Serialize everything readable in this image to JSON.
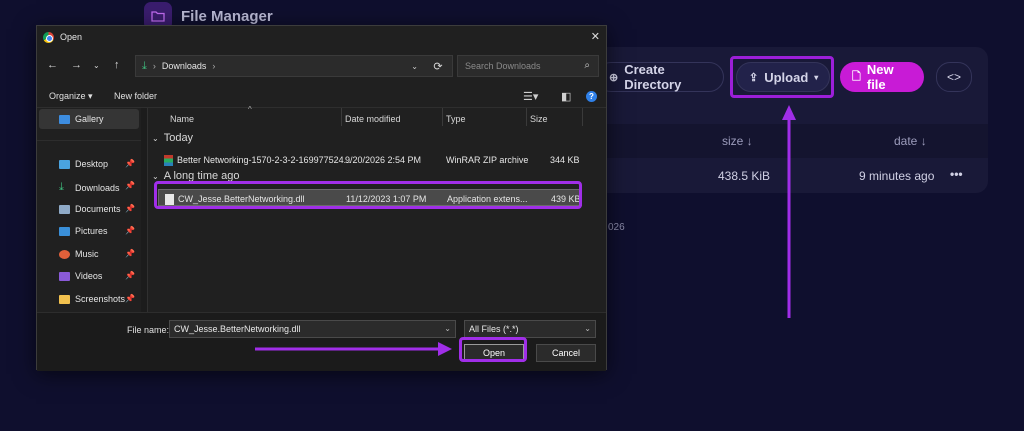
{
  "app": {
    "title": "File Manager",
    "buttons": {
      "create_directory": "Create Directory",
      "upload": "Upload",
      "new_file": "New file",
      "code": "<>"
    },
    "table": {
      "columns": {
        "size": "size ↓",
        "date": "date ↓"
      },
      "row": {
        "size": "438.5 KiB",
        "date": "9 minutes ago",
        "menu": "•••"
      }
    },
    "fragment_text": "026",
    "colors": {
      "accent": "#c81bd6",
      "background": "#0f0f2e",
      "annotation": "#a02ee8"
    }
  },
  "dialog": {
    "title": "Open",
    "close": "✕",
    "address": {
      "path": "Downloads",
      "separator": "›"
    },
    "search_placeholder": "Search Downloads",
    "toolbar": {
      "organize": "Organize ▾",
      "new_folder": "New folder"
    },
    "sidebar": {
      "items": [
        {
          "label": "Gallery",
          "icon": "gallery-icon",
          "pinned": false,
          "selected": true
        },
        {
          "label": "Desktop",
          "icon": "desktop-icon",
          "pinned": true
        },
        {
          "label": "Downloads",
          "icon": "downloads-icon",
          "pinned": true
        },
        {
          "label": "Documents",
          "icon": "documents-icon",
          "pinned": true
        },
        {
          "label": "Pictures",
          "icon": "pictures-icon",
          "pinned": true
        },
        {
          "label": "Music",
          "icon": "music-icon",
          "pinned": true
        },
        {
          "label": "Videos",
          "icon": "videos-icon",
          "pinned": true
        },
        {
          "label": "Screenshots",
          "icon": "folder-icon",
          "pinned": true
        }
      ]
    },
    "columns": {
      "name": "Name",
      "date": "Date modified",
      "type": "Type",
      "size": "Size"
    },
    "groups": [
      {
        "label": "Today",
        "files": [
          {
            "name": "Better Networking-1570-2-3-2-169977524...",
            "date": "9/20/2026 2:54 PM",
            "type": "WinRAR ZIP archive",
            "size": "344 KB"
          }
        ]
      },
      {
        "label": "A long time ago",
        "files": [
          {
            "name": "CW_Jesse.BetterNetworking.dll",
            "date": "11/12/2023 1:07 PM",
            "type": "Application extens...",
            "size": "439 KB"
          }
        ]
      }
    ],
    "file_name_label": "File name:",
    "file_name_value": "CW_Jesse.BetterNetworking.dll",
    "file_type_value": "All Files (*.*)",
    "open_label": "Open",
    "cancel_label": "Cancel"
  }
}
